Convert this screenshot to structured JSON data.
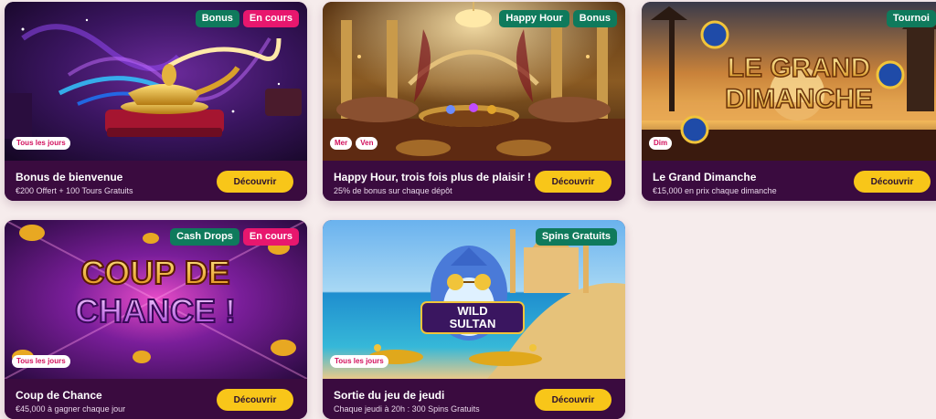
{
  "cards": [
    {
      "badges": [
        "Bonus",
        "En cours"
      ],
      "days": [
        "Tous les jours"
      ],
      "title": "Bonus de bienvenue",
      "subtitle": "€200 Offert + 100 Tours Gratuits",
      "button": "Découvrir"
    },
    {
      "badges": [
        "Happy Hour",
        "Bonus"
      ],
      "days": [
        "Mer",
        "Ven"
      ],
      "title": "Happy Hour, trois fois plus de plaisir !",
      "subtitle": "25% de bonus sur chaque dépôt",
      "button": "Découvrir"
    },
    {
      "badges": [
        "Tournoi"
      ],
      "days": [
        "Dim"
      ],
      "image_text": [
        "LE GRAND",
        "DIMANCHE"
      ],
      "title": "Le Grand Dimanche",
      "subtitle": "€15,000 en prix chaque dimanche",
      "button": "Découvrir"
    },
    {
      "badges": [
        "Cash Drops",
        "En cours"
      ],
      "days": [
        "Tous les jours"
      ],
      "image_text": [
        "COUP DE",
        "CHANCE !"
      ],
      "title": "Coup de Chance",
      "subtitle": "€45,000 à gagner chaque jour",
      "button": "Découvrir"
    },
    {
      "badges": [
        "Spins Gratuits"
      ],
      "days": [
        "Tous les jours"
      ],
      "image_text": [
        "WILD",
        "SULTAN"
      ],
      "title": "Sortie du jeu de jeudi",
      "subtitle": "Chaque jeudi à 20h : 300 Spins Gratuits",
      "button": "Découvrir"
    }
  ],
  "colors": {
    "page_background": "#f6ecec",
    "card_footer": "#3a0b3f",
    "badge_green": "#0f7a5c",
    "badge_pink": "#e8176e",
    "button": "#f8c619"
  }
}
